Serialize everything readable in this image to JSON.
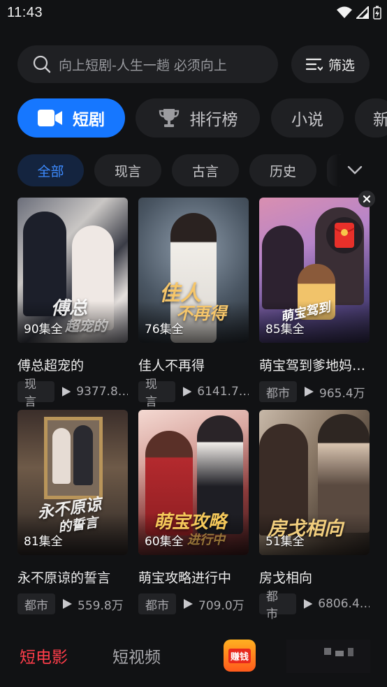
{
  "status_bar": {
    "time": "11:43"
  },
  "search": {
    "placeholder": "向上短剧-人生一趟 必须向上",
    "filter_label": "筛选"
  },
  "categories": [
    {
      "label": "短剧",
      "icon": "video-camera-icon",
      "active": true
    },
    {
      "label": "排行榜",
      "icon": "trophy-icon",
      "active": false
    },
    {
      "label": "小说",
      "active": false
    },
    {
      "label": "新",
      "active": false
    }
  ],
  "genres": [
    {
      "label": "全部",
      "active": true
    },
    {
      "label": "现言",
      "active": false
    },
    {
      "label": "古言",
      "active": false
    },
    {
      "label": "历史",
      "active": false
    }
  ],
  "dramas": [
    {
      "title": "傅总超宠的",
      "episodes": "90集全",
      "genre": "现言",
      "plays": "9377.8…",
      "poster_text": "傅总",
      "poster_text2": "超宠的"
    },
    {
      "title": "佳人不再得",
      "episodes": "76集全",
      "genre": "现言",
      "plays": "6141.7…",
      "poster_text": "佳人",
      "poster_text2": "不再得"
    },
    {
      "title": "萌宝驾到爹地妈…",
      "episodes": "85集全",
      "genre": "都市",
      "plays": "965.4万",
      "poster_text": "萌宝驾到",
      "poster_text2": ""
    },
    {
      "title": "永不原谅的誓言",
      "episodes": "81集全",
      "genre": "都市",
      "plays": "559.8万",
      "poster_text": "永不原谅",
      "poster_text2": "的誓言"
    },
    {
      "title": "萌宝攻略进行中",
      "episodes": "60集全",
      "genre": "都市",
      "plays": "709.0万",
      "poster_text": "萌宝攻略",
      "poster_text2": "进行中"
    },
    {
      "title": "房戈相向",
      "episodes": "51集全",
      "genre": "都市",
      "plays": "6806.4…",
      "poster_text": "房戈相向",
      "poster_text2": ""
    }
  ],
  "bottom_nav": {
    "items": [
      {
        "label": "短电影",
        "active": true
      },
      {
        "label": "短视频",
        "active": false
      }
    ],
    "earn_label": "赚钱"
  },
  "colors": {
    "accent": "#1677ff",
    "nav_active": "#ff3d4a",
    "background": "#111214"
  }
}
